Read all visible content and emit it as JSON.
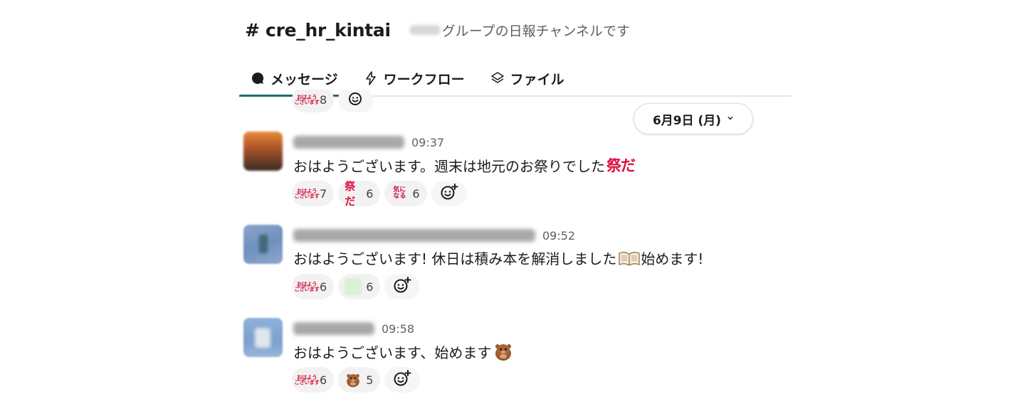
{
  "channel": {
    "name": "# cre_hr_kintai",
    "description": "グループの日報チャンネルです"
  },
  "tabs": [
    {
      "label": "メッセージ",
      "icon": "chat-bubble-icon",
      "active": true
    },
    {
      "label": "ワークフロー",
      "icon": "lightning-icon",
      "active": false
    },
    {
      "label": "ファイル",
      "icon": "layers-icon",
      "active": false
    }
  ],
  "date_divider": {
    "label": "6月9日 (月)"
  },
  "top_partial_reactions": [
    {
      "emoji": "ohayou-emoji",
      "count": "8"
    }
  ],
  "messages": [
    {
      "time": "09:37",
      "text": "おはようございます。週末は地元のお祭りでした",
      "inline_emoji": "matsurida-emoji",
      "inline_emoji_text": "祭だ",
      "text_after": "",
      "reactions": [
        {
          "emoji": "ohayou-emoji",
          "count": "7"
        },
        {
          "emoji": "matsurida-emoji",
          "count": "6"
        },
        {
          "emoji": "kininaru-emoji",
          "count": "6"
        }
      ]
    },
    {
      "time": "09:52",
      "text": "おはようございます! 休日は積み本を解消しました",
      "inline_emoji": "open-book-emoji",
      "inline_emoji_text": "",
      "text_after": " 始めます!",
      "reactions": [
        {
          "emoji": "ohayou-emoji",
          "count": "6"
        },
        {
          "emoji": "green-custom-emoji",
          "count": "6"
        }
      ]
    },
    {
      "time": "09:58",
      "text": "おはようございます、始めます",
      "inline_emoji": "otter-emoji",
      "inline_emoji_text": "",
      "text_after": "",
      "reactions": [
        {
          "emoji": "ohayou-emoji",
          "count": "6"
        },
        {
          "emoji": "otter-emoji",
          "count": "5"
        }
      ]
    }
  ],
  "emoji_text": {
    "ohayou_top": "おはよう",
    "ohayou_bottom": "ございます",
    "matsurida": "祭だ",
    "kini_top": "気に",
    "kini_bottom": "なる"
  },
  "colors": {
    "accent_tab": "#1c6b70",
    "emoji_red": "#d0103a",
    "reaction_bg": "#f2f2f2"
  }
}
